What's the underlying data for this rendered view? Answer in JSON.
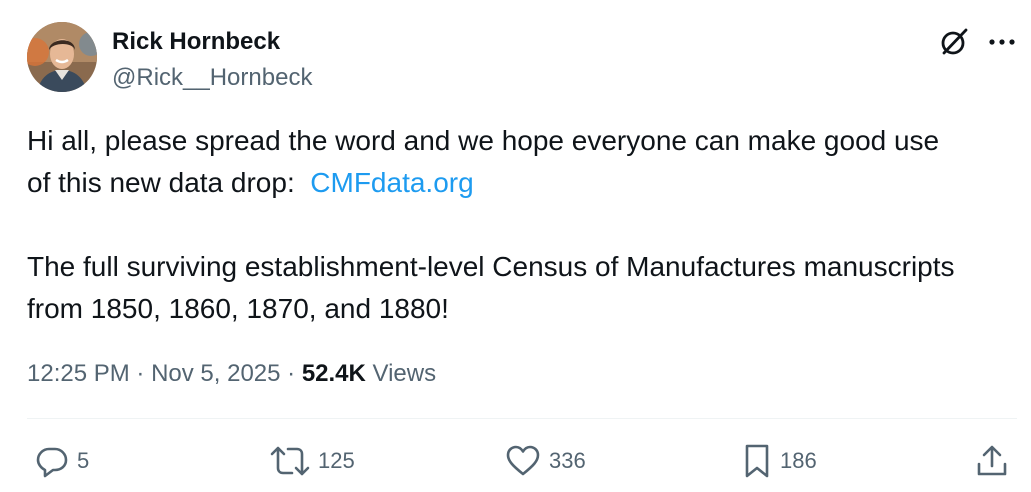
{
  "author": {
    "display_name": "Rick Hornbeck",
    "handle": "@Rick__Hornbeck",
    "avatar_icon": "profile-photo"
  },
  "header_actions": {
    "grok_icon": "grok-icon",
    "more_icon": "more-options-icon"
  },
  "tweet": {
    "line1": "Hi all, please spread the word and we hope everyone can make good use",
    "line2_prefix": "of this new data drop:  ",
    "link_text": "CMFdata.org",
    "line3": "The full surviving establishment-level Census of Manufactures manuscripts",
    "line4": "from 1850, 1860, 1870, and 1880!"
  },
  "meta": {
    "time": "12:25 PM",
    "separator": " · ",
    "date": "Nov 5, 2025",
    "views_count": "52.4K",
    "views_label": " Views"
  },
  "actions": {
    "replies": "5",
    "reposts": "125",
    "likes": "336",
    "bookmarks": "186"
  },
  "colors": {
    "text": "#0f1419",
    "secondary": "#536471",
    "link": "#1d9bf0",
    "divider": "#eff3f4"
  }
}
